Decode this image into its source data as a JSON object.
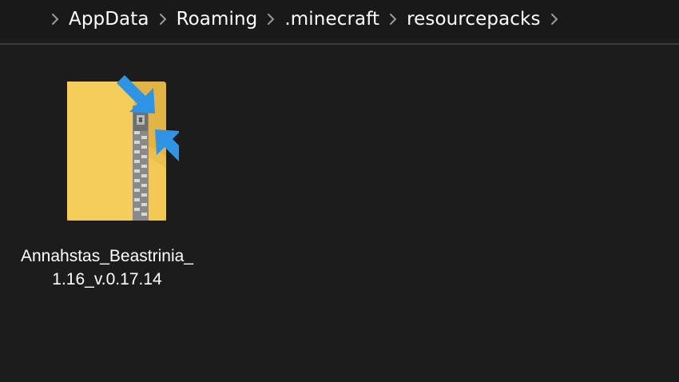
{
  "breadcrumb": {
    "items": [
      {
        "label": "AppData"
      },
      {
        "label": "Roaming"
      },
      {
        "label": ".minecraft"
      },
      {
        "label": "resourcepacks"
      }
    ],
    "separator_icon": "chevron-right-icon"
  },
  "files": [
    {
      "name": "Annahstas_Beastrinia_1.16_v.0.17.14",
      "icon": "compressed-zip-folder-icon"
    }
  ],
  "colors": {
    "background": "#1c1c1c",
    "folder_yellow": "#f5cd5b",
    "arrow_blue": "#2f94e6",
    "text": "#ffffff"
  }
}
